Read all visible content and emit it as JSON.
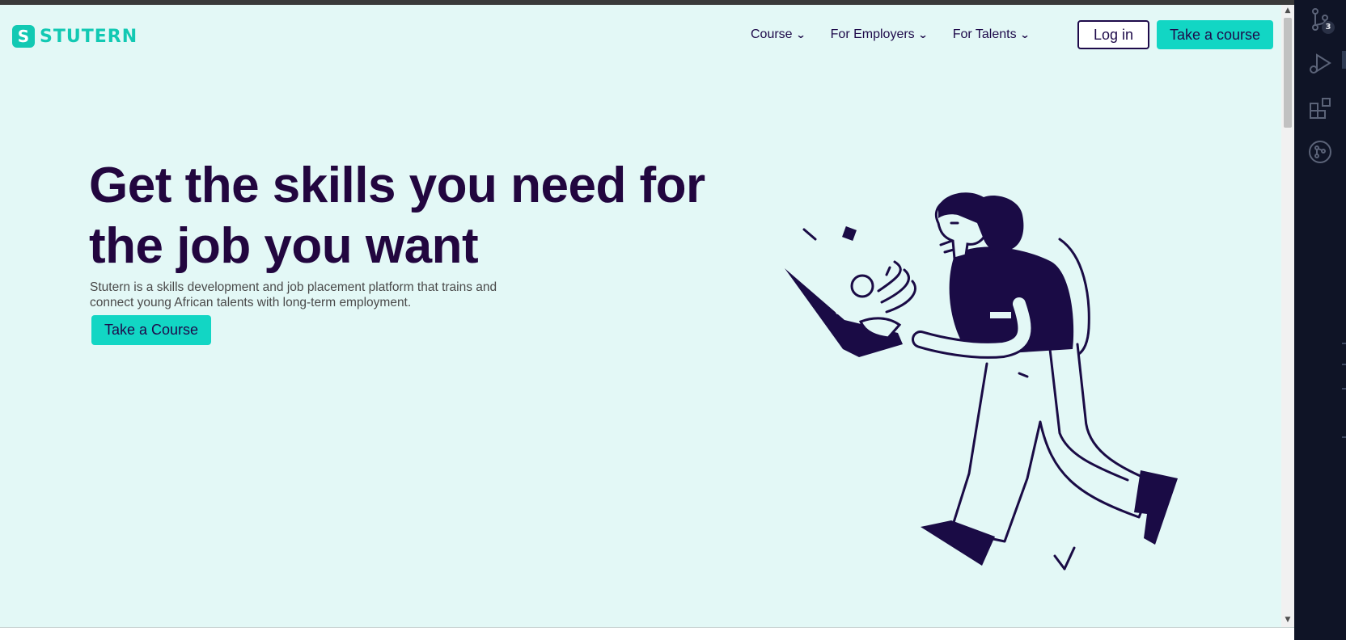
{
  "header": {
    "logo_letter": "S",
    "logo_text": "STUTERN",
    "nav": [
      {
        "label": "Course"
      },
      {
        "label": "For Employers"
      },
      {
        "label": "For Talents"
      }
    ],
    "login_label": "Log in",
    "take_course_label": "Take a course"
  },
  "hero": {
    "title_line1": "Get the skills you need for",
    "title_line2": "the job you want",
    "subtitle_line1": "Stutern is a skills development and job placement platform that trains and",
    "subtitle_line2": "connect young African talents with long-term employment.",
    "cta_label": "Take a Course"
  },
  "sidebar": {
    "source_control_badge": "3",
    "icons": [
      "source-control-icon",
      "run-debug-icon",
      "extensions-icon",
      "git-graph-icon"
    ]
  },
  "colors": {
    "background": "#e3f8f6",
    "brand": "#12c9b3",
    "accent_button": "#12d6c4",
    "heading": "#22063f",
    "sidebar": "#0f1426"
  }
}
